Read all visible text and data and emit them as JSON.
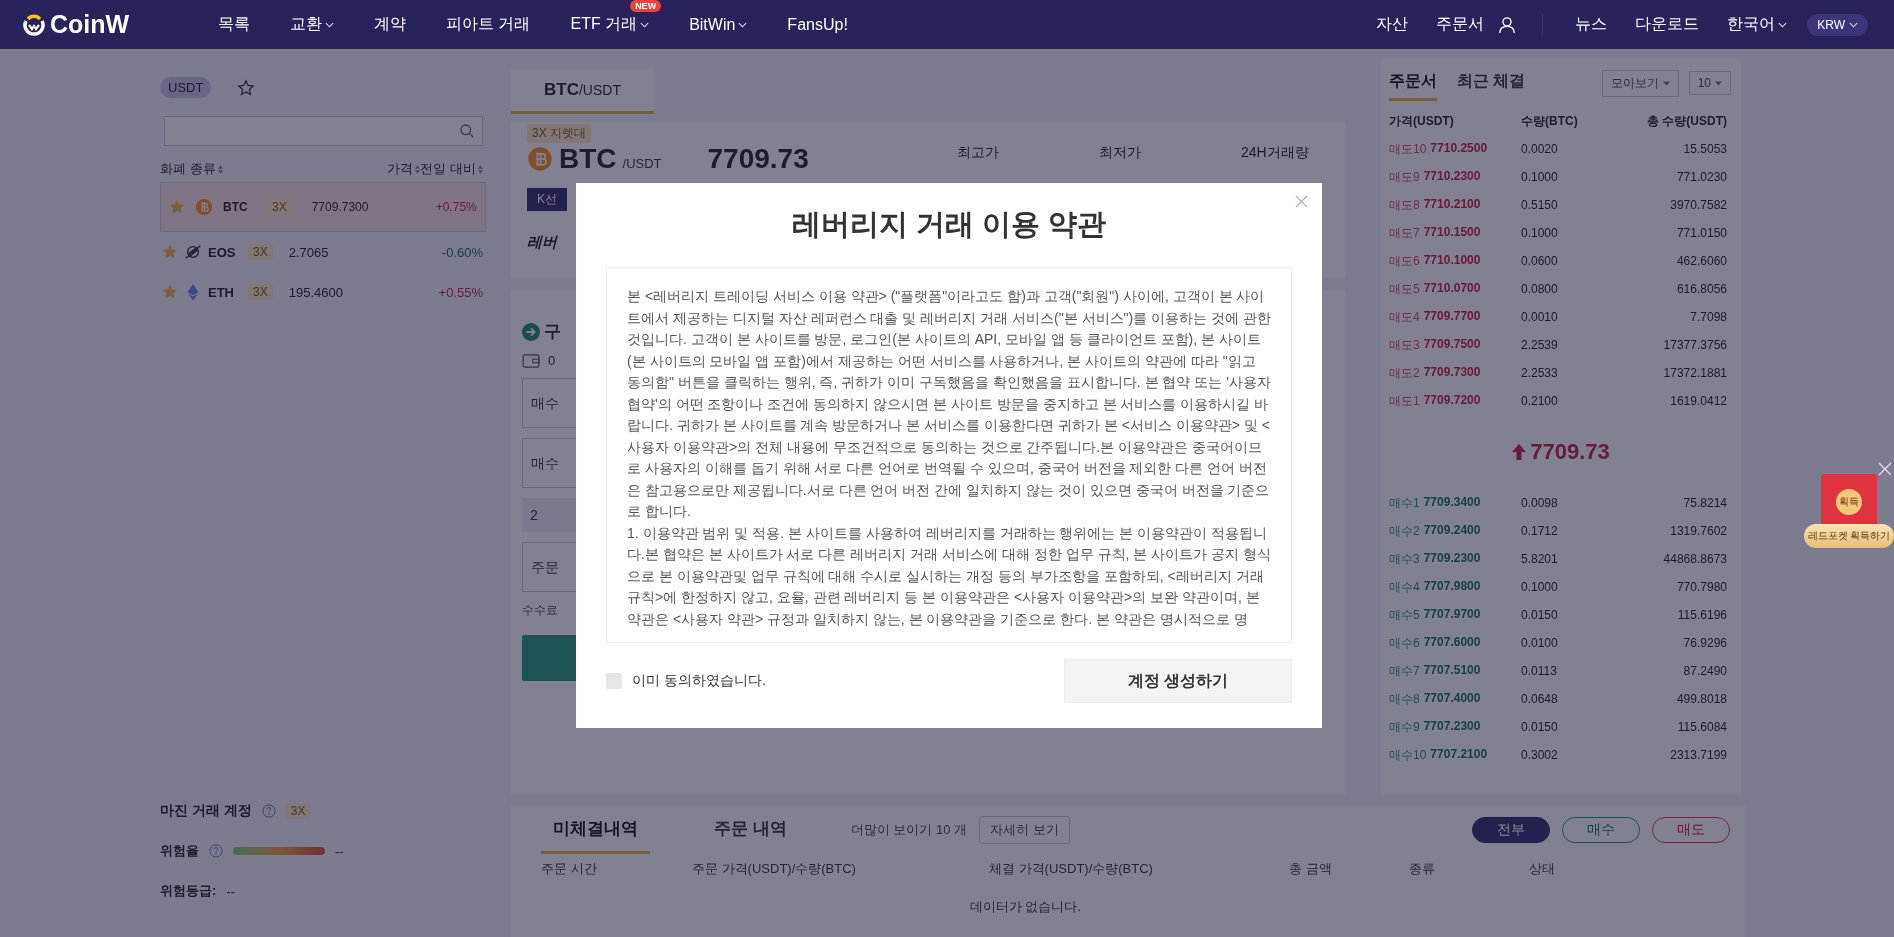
{
  "nav": {
    "logo": "CoinW",
    "items": [
      {
        "label": "목록",
        "dropdown": false
      },
      {
        "label": "교환",
        "dropdown": true
      },
      {
        "label": "계약",
        "dropdown": false
      },
      {
        "label": "피아트 거래",
        "dropdown": false
      },
      {
        "label": "ETF 거래",
        "dropdown": true,
        "badge": "NEW"
      },
      {
        "label": "BitWin",
        "dropdown": true
      },
      {
        "label": "FansUp!",
        "dropdown": false
      }
    ],
    "account_links": [
      "자산",
      "주문서"
    ],
    "links": [
      {
        "label": "뉴스",
        "dropdown": false
      },
      {
        "label": "다운로드",
        "dropdown": false
      },
      {
        "label": "한국어",
        "dropdown": true
      }
    ],
    "currency": "KRW"
  },
  "market": {
    "tab": "USDT",
    "columns": [
      "화폐 종류",
      "가격",
      "전일 대비"
    ],
    "rows": [
      {
        "name": "BTC",
        "leverage": "3X",
        "price": "7709.7300",
        "change": "+0.75%",
        "rising": true,
        "favorite": true,
        "selected": true
      },
      {
        "name": "EOS",
        "leverage": "3X",
        "price": "2.7065",
        "change": "-0.60%",
        "rising": false,
        "favorite": true,
        "selected": false
      },
      {
        "name": "ETH",
        "leverage": "3X",
        "price": "195.4600",
        "change": "+0.55%",
        "rising": true,
        "favorite": true,
        "selected": false
      }
    ]
  },
  "margin_account": {
    "title": "마진 거래 계정",
    "leverage": "3X",
    "risk_rate": {
      "label": "위험율",
      "value": "--"
    },
    "risk_level": {
      "label": "위험등급:",
      "value": "--"
    }
  },
  "ticker": {
    "pair_tab": {
      "base": "BTC",
      "quote": "/USDT"
    },
    "leverage_badge": "3X 지렛대",
    "symbol": "BTC",
    "quote": "/USDT",
    "price": "7709.73",
    "stats": [
      "최고가",
      "최저가",
      "24H거래량"
    ],
    "kline_button": "K선",
    "section_tab": "레버"
  },
  "trade": {
    "title": "구",
    "balance": "0",
    "fields": [
      {
        "placeholder": "매수"
      },
      {
        "placeholder": "매수"
      },
      {
        "placeholder": "2"
      },
      {
        "placeholder": "주문"
      }
    ],
    "fee": "수수료"
  },
  "orders": {
    "tabs": [
      {
        "label": "미체결내역",
        "selected": true
      },
      {
        "label": "주문 내역",
        "selected": false
      }
    ],
    "show_more": "더많이 보이기 10 개",
    "detail_button": "자세히 보기",
    "filters": [
      {
        "label": "전부",
        "kind": "all",
        "selected": true
      },
      {
        "label": "매수",
        "kind": "buy",
        "selected": false
      },
      {
        "label": "매도",
        "kind": "sell",
        "selected": false
      }
    ],
    "columns": [
      "주문 시간",
      "주문 가격(USDT)/수량(BTC)",
      "체결 가격(USDT)/수량(BTC)",
      "총 금액",
      "종류",
      "상태"
    ],
    "empty_text": "데이터가 없습니다."
  },
  "orderbook": {
    "tabs": [
      {
        "label": "주문서",
        "selected": true
      },
      {
        "label": "최근 체결",
        "selected": false
      }
    ],
    "group_select": "모아보기",
    "depth_select": "10",
    "columns": [
      "가격(USDT)",
      "수량(BTC)",
      "총 수량(USDT)"
    ],
    "asks": [
      {
        "label": "매도10",
        "price": "7710.2500",
        "amount": "0.0020",
        "total": "15.5053"
      },
      {
        "label": "매도9",
        "price": "7710.2300",
        "amount": "0.1000",
        "total": "771.0230"
      },
      {
        "label": "매도8",
        "price": "7710.2100",
        "amount": "0.5150",
        "total": "3970.7582"
      },
      {
        "label": "매도7",
        "price": "7710.1500",
        "amount": "0.1000",
        "total": "771.0150"
      },
      {
        "label": "매도6",
        "price": "7710.1000",
        "amount": "0.0600",
        "total": "462.6060"
      },
      {
        "label": "매도5",
        "price": "7710.0700",
        "amount": "0.0800",
        "total": "616.8056"
      },
      {
        "label": "매도4",
        "price": "7709.7700",
        "amount": "0.0010",
        "total": "7.7098"
      },
      {
        "label": "매도3",
        "price": "7709.7500",
        "amount": "2.2539",
        "total": "17377.3756"
      },
      {
        "label": "매도2",
        "price": "7709.7300",
        "amount": "2.2533",
        "total": "17372.1881"
      },
      {
        "label": "매도1",
        "price": "7709.7200",
        "amount": "0.2100",
        "total": "1619.0412"
      }
    ],
    "last_price": "7709.73",
    "last_rising": true,
    "bids": [
      {
        "label": "매수1",
        "price": "7709.3400",
        "amount": "0.0098",
        "total": "75.8214"
      },
      {
        "label": "매수2",
        "price": "7709.2400",
        "amount": "0.1712",
        "total": "1319.7602"
      },
      {
        "label": "매수3",
        "price": "7709.2300",
        "amount": "5.8201",
        "total": "44868.8673"
      },
      {
        "label": "매수4",
        "price": "7707.9800",
        "amount": "0.1000",
        "total": "770.7980"
      },
      {
        "label": "매수5",
        "price": "7707.9700",
        "amount": "0.0150",
        "total": "115.6196"
      },
      {
        "label": "매수6",
        "price": "7707.6000",
        "amount": "0.0100",
        "total": "76.9296"
      },
      {
        "label": "매수7",
        "price": "7707.5100",
        "amount": "0.0113",
        "total": "87.2490"
      },
      {
        "label": "매수8",
        "price": "7707.4000",
        "amount": "0.0648",
        "total": "499.8018"
      },
      {
        "label": "매수9",
        "price": "7707.2300",
        "amount": "0.0150",
        "total": "115.6084"
      },
      {
        "label": "매수10",
        "price": "7707.2100",
        "amount": "0.3002",
        "total": "2313.7199"
      }
    ]
  },
  "modal": {
    "title": "레버리지 거래 이용 약관",
    "paragraphs": [
      "본 <레버리지 트레이딩 서비스 이용 약관> (\"플랫폼\"이라고도 함)과 고객(\"회원\") 사이에, 고객이 본 사이트에서 제공하는 디지털 자산 레퍼런스 대출 및 레버리지 거래 서비스(\"본 서비스\")를 이용하는 것에 관한 것입니다. 고객이 본 사이트를 방문, 로그인(본 사이트의 API, 모바일 앱 등 클라이언트 포함), 본 사이트(본 사이트의 모바일 앱 포함)에서 제공하는 어떤 서비스를 사용하거나, 본 사이트의 약관에 따라 \"읽고 동의함\" 버튼을 클릭하는 행위, 즉, 귀하가 이미 구독했음을 확인했음을 표시합니다. 본 협약 또는 '사용자 협약'의 어떤 조항이나 조건에 동의하지 않으시면 본 사이트 방문을 중지하고 본 서비스를 이용하시길 바랍니다. 귀하가 본 사이트를 계속 방문하거나 본 서비스를 이용한다면 귀하가 본 <서비스 이용약관> 및 <사용자 이용약관>의 전체 내용에 무조건적으로 동의하는 것으로 간주됩니다.본 이용약관은 중국어이므로 사용자의 이해를 돕기 위해 서로 다른 언어로 번역될 수 있으며, 중국어 버전을 제외한 다른 언어 버전은 참고용으로만 제공됩니다.서로 다른 언어 버전 간에 일치하지 않는 것이 있으면 중국어 버전을 기준으로 합니다.",
      "1. 이용약관 범위 및 적용. 본 사이트를 사용하여 레버리지를 거래하는 행위에는 본 이용약관이 적용됩니다.본 협약은 본 사이트가 서로 다른 레버리지 거래 서비스에 대해 정한 업무 규칙, 본 사이트가 공지 형식으로 본 이용약관및 업무 규칙에 대해 수시로 실시하는 개정 등의 부가조항을 포함하되, <레버리지 거래 규칙>에 한정하지 않고, 요율, 관련 레버리지 등 본 이용약관은 <사용자 이용약관>의 보완 약관이며, 본 약관은 <사용자 약관> 규정과 일치하지 않는, 본 이용약관을 기준으로 한다. 본 약관은 명시적으로 명"
    ],
    "agree": {
      "label": "이미 동의하였습니다.",
      "checked": false
    },
    "submit": "계정 생성하기"
  },
  "red_packet": {
    "seal": "획득",
    "button": "레드포켓 획득하기"
  }
}
